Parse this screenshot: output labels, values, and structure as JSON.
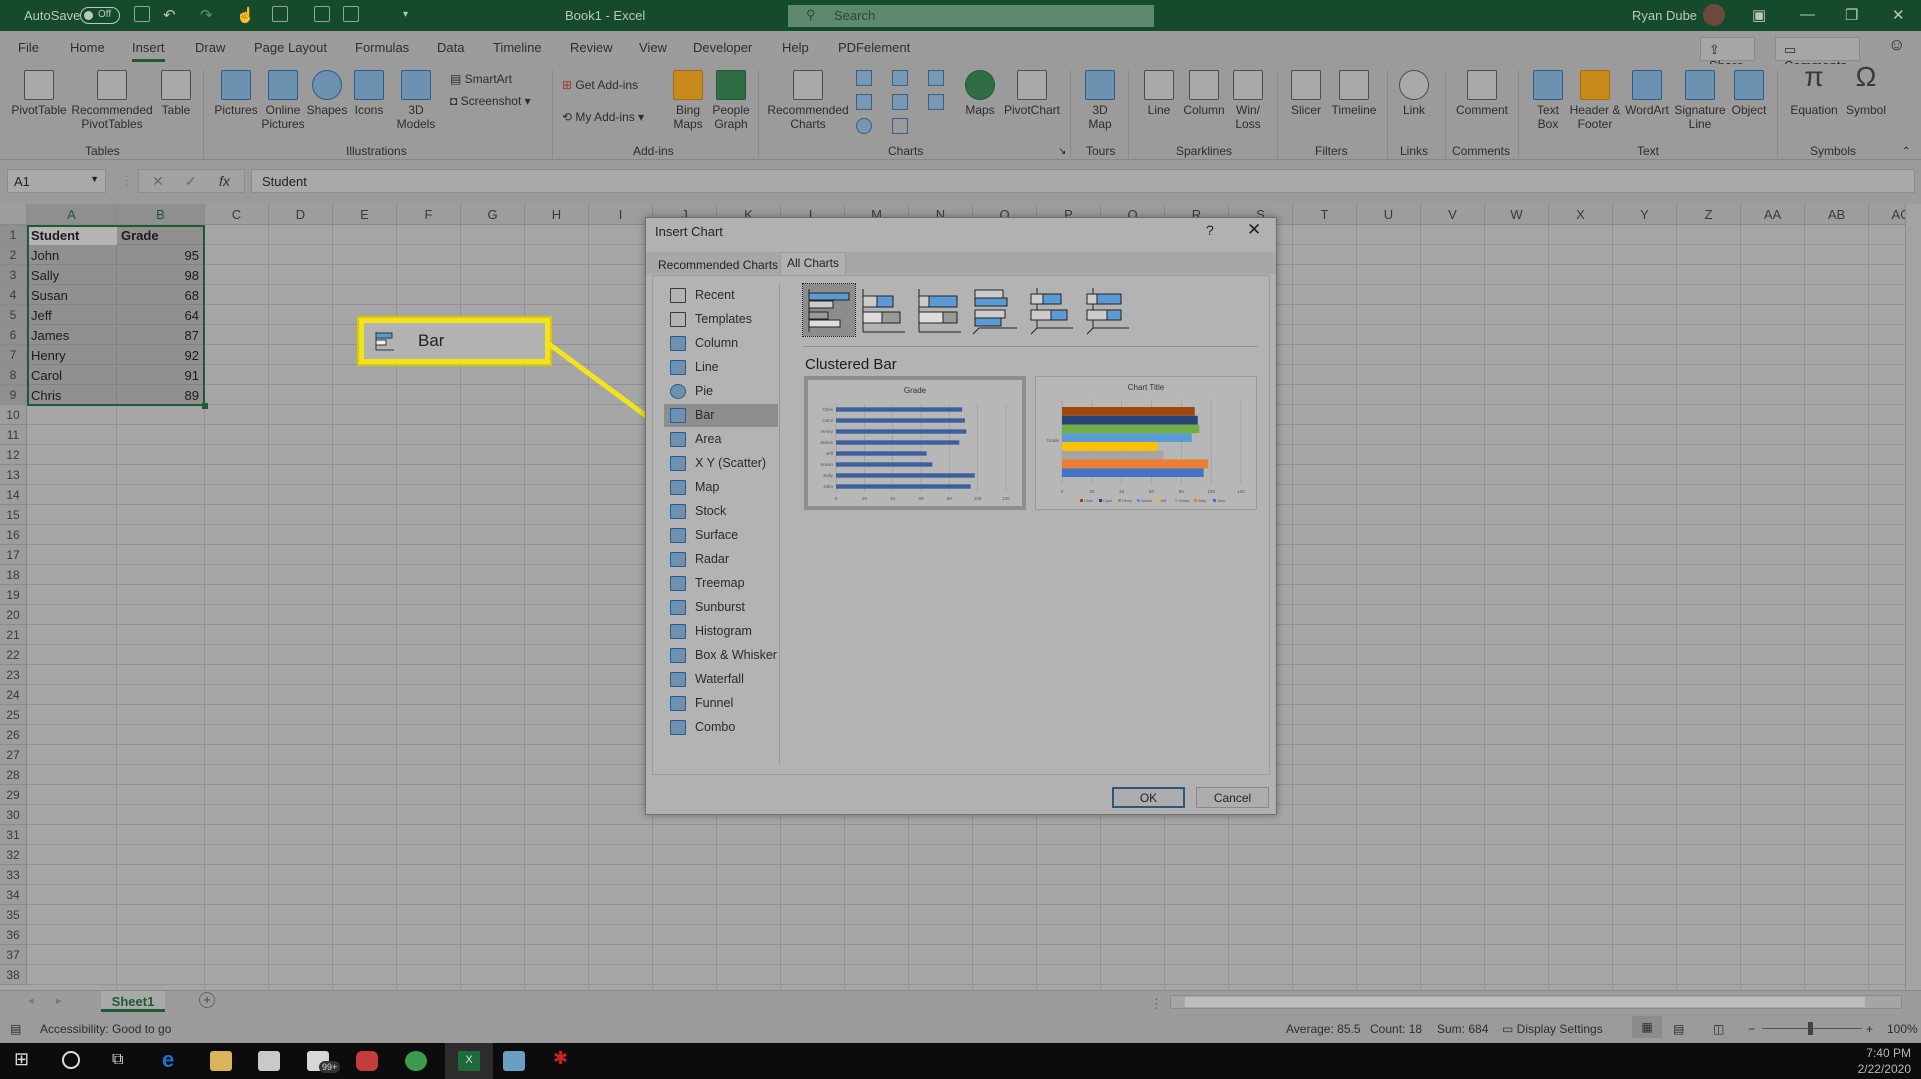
{
  "titlebar": {
    "autosave_label": "AutoSave",
    "autosave_state": "Off",
    "doc_title": "Book1  -  Excel",
    "search_placeholder": "Search",
    "user_name": "Ryan Dube"
  },
  "tabs": [
    "File",
    "Home",
    "Insert",
    "Draw",
    "Page Layout",
    "Formulas",
    "Data",
    "Timeline",
    "Review",
    "View",
    "Developer",
    "Help",
    "PDFelement"
  ],
  "active_tab": "Insert",
  "share_label": "Share",
  "comments_label": "Comments",
  "ribbon": {
    "groups": [
      {
        "name": "Tables",
        "buttons": [
          "PivotTable",
          "Recommended PivotTables",
          "Table"
        ]
      },
      {
        "name": "Illustrations",
        "buttons": [
          "Pictures",
          "Online Pictures",
          "Shapes",
          "Icons",
          "3D Models",
          "SmartArt",
          "Screenshot"
        ]
      },
      {
        "name": "Add-ins",
        "buttons": [
          "Get Add-ins",
          "My Add-ins",
          "Bing Maps",
          "People Graph"
        ]
      },
      {
        "name": "Charts",
        "buttons": [
          "Recommended Charts",
          "Maps",
          "PivotChart"
        ]
      },
      {
        "name": "Tours",
        "buttons": [
          "3D Map"
        ]
      },
      {
        "name": "Sparklines",
        "buttons": [
          "Line",
          "Column",
          "Win/ Loss"
        ]
      },
      {
        "name": "Filters",
        "buttons": [
          "Slicer",
          "Timeline"
        ]
      },
      {
        "name": "Links",
        "buttons": [
          "Link"
        ]
      },
      {
        "name": "Comments",
        "buttons": [
          "Comment"
        ]
      },
      {
        "name": "Text",
        "buttons": [
          "Text Box",
          "Header & Footer",
          "WordArt",
          "Signature Line",
          "Object"
        ]
      },
      {
        "name": "Symbols",
        "buttons": [
          "Equation",
          "Symbol"
        ]
      }
    ]
  },
  "formula_bar": {
    "name_box": "A1",
    "fx": "fx",
    "value": "Student"
  },
  "columns": [
    "A",
    "B",
    "C",
    "D",
    "E",
    "F",
    "G",
    "H",
    "I",
    "J",
    "K",
    "L",
    "M",
    "N",
    "O",
    "P",
    "Q",
    "R",
    "S",
    "T",
    "U",
    "V",
    "W",
    "X",
    "Y",
    "Z",
    "AA",
    "AB",
    "AC"
  ],
  "rows_count": 38,
  "sheet": {
    "headers": [
      "Student",
      "Grade"
    ],
    "rows": [
      [
        "John",
        "95"
      ],
      [
        "Sally",
        "98"
      ],
      [
        "Susan",
        "68"
      ],
      [
        "Jeff",
        "64"
      ],
      [
        "James",
        "87"
      ],
      [
        "Henry",
        "92"
      ],
      [
        "Carol",
        "91"
      ],
      [
        "Chris",
        "89"
      ]
    ]
  },
  "callout": {
    "label": "Bar",
    "color": "#f2e41b"
  },
  "sheet_tabs": [
    "Sheet1"
  ],
  "status": {
    "accessibility": "Accessibility: Good to go",
    "average": "Average: 85.5",
    "count": "Count: 18",
    "sum": "Sum: 684",
    "display_settings": "Display Settings",
    "zoom": "100%"
  },
  "taskbar": {
    "mail_badge": "99+",
    "time": "7:40 PM",
    "date": "2/22/2020"
  },
  "dialog": {
    "title": "Insert Chart",
    "help": "?",
    "tabs": [
      "Recommended Charts",
      "All Charts"
    ],
    "active_tab": "All Charts",
    "chart_types": [
      "Recent",
      "Templates",
      "Column",
      "Line",
      "Pie",
      "Bar",
      "Area",
      "X Y (Scatter)",
      "Map",
      "Stock",
      "Surface",
      "Radar",
      "Treemap",
      "Sunburst",
      "Histogram",
      "Box & Whisker",
      "Waterfall",
      "Funnel",
      "Combo"
    ],
    "selected_type": "Bar",
    "subtypes": [
      "Clustered Bar",
      "Stacked Bar",
      "100% Stacked Bar",
      "3-D Clustered Bar",
      "3-D Stacked Bar",
      "3-D 100% Stacked Bar"
    ],
    "selected_subtype_title": "Clustered Bar",
    "ok_label": "OK",
    "cancel_label": "Cancel"
  },
  "chart_data": [
    {
      "type": "bar",
      "title": "Grade",
      "categories": [
        "John",
        "Sally",
        "Susan",
        "Jeff",
        "James",
        "Henry",
        "Carol",
        "Chris"
      ],
      "values": [
        95,
        98,
        68,
        64,
        87,
        92,
        91,
        89
      ],
      "xlim": [
        0,
        120
      ],
      "ticks": [
        0,
        20,
        40,
        60,
        80,
        100,
        120
      ],
      "color": "#3e5f9c"
    },
    {
      "type": "bar",
      "title": "Chart Title",
      "categories": [
        "Grade"
      ],
      "series": [
        {
          "name": "John",
          "values": [
            95
          ],
          "color": "#4472c4"
        },
        {
          "name": "Sally",
          "values": [
            98
          ],
          "color": "#ed7d31"
        },
        {
          "name": "Susan",
          "values": [
            68
          ],
          "color": "#a5a5a5"
        },
        {
          "name": "Jeff",
          "values": [
            64
          ],
          "color": "#ffc000"
        },
        {
          "name": "James",
          "values": [
            87
          ],
          "color": "#5b9bd5"
        },
        {
          "name": "Henry",
          "values": [
            92
          ],
          "color": "#70ad47"
        },
        {
          "name": "Carol",
          "values": [
            91
          ],
          "color": "#264478"
        },
        {
          "name": "Chris",
          "values": [
            89
          ],
          "color": "#9e480e"
        }
      ],
      "xlim": [
        0,
        120
      ],
      "ticks": [
        0,
        20,
        40,
        60,
        80,
        100,
        120
      ],
      "legend": "bottom"
    }
  ]
}
